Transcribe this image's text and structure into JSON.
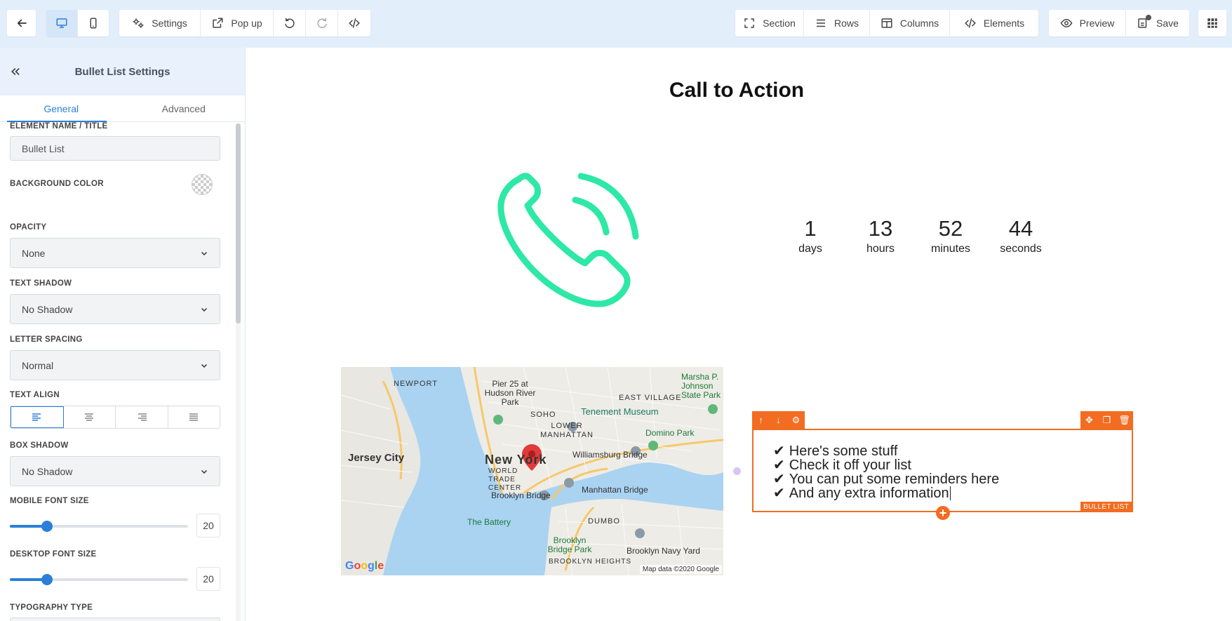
{
  "toolbar": {
    "back_icon": "arrow-left-icon",
    "devices": [
      {
        "name": "desktop",
        "icon": "desktop-icon",
        "active": true
      },
      {
        "name": "mobile",
        "icon": "mobile-icon",
        "active": false
      }
    ],
    "settings_label": "Settings",
    "popup_label": "Pop up",
    "section_label": "Section",
    "rows_label": "Rows",
    "columns_label": "Columns",
    "elements_label": "Elements",
    "preview_label": "Preview",
    "save_label": "Save"
  },
  "panel": {
    "title": "Bullet List Settings",
    "tabs": [
      {
        "label": "General",
        "active": true
      },
      {
        "label": "Advanced",
        "active": false
      }
    ],
    "fields": {
      "element_name_label": "ELEMENT NAME / TITLE",
      "element_name_value": "Bullet List",
      "bg_color_label": "BACKGROUND COLOR",
      "opacity_label": "OPACITY",
      "opacity_value": "None",
      "text_shadow_label": "TEXT SHADOW",
      "text_shadow_value": "No Shadow",
      "letter_spacing_label": "LETTER SPACING",
      "letter_spacing_value": "Normal",
      "text_align_label": "TEXT ALIGN",
      "text_align_selected": "left",
      "box_shadow_label": "BOX SHADOW",
      "box_shadow_value": "No Shadow",
      "mobile_font_label": "MOBILE FONT SIZE",
      "mobile_font_value": "20",
      "mobile_font_fraction": 0.21,
      "desktop_font_label": "DESKTOP FONT SIZE",
      "desktop_font_value": "20",
      "desktop_font_fraction": 0.21,
      "typography_label": "TYPOGRAPHY TYPE"
    }
  },
  "canvas": {
    "title": "Call to Action",
    "phone_icon": "phone-ringing-icon",
    "phone_color": "#2de8a6",
    "countdown": [
      {
        "value": "1",
        "unit": "days"
      },
      {
        "value": "13",
        "unit": "hours"
      },
      {
        "value": "52",
        "unit": "minutes"
      },
      {
        "value": "44",
        "unit": "seconds"
      }
    ],
    "map": {
      "labels": {
        "jersey_city": "Jersey City",
        "new_york": "New York",
        "newport": "NEWPORT",
        "pier25": "Pier 25 at Hudson River Park",
        "soho": "SOHO",
        "east_village": "EAST VILLAGE",
        "lower_manhattan": "LOWER MANHATTAN",
        "tenement": "Tenement Museum",
        "world_trade": "WORLD TRADE CENTER",
        "williamsburg": "Williamsburg Bridge",
        "domino": "Domino Park",
        "marsha": "Marsha P. Johnson State Park",
        "brooklyn_bridge": "Brooklyn Bridge",
        "manhattan_bridge": "Manhattan Bridge",
        "battery": "The Battery",
        "dumbo": "DUMBO",
        "navy_yard": "Brooklyn Navy Yard",
        "brooklyn_heights": "Brooklyn Bridge Park",
        "brooklyn_heights_area": "BROOKLYN HEIGHTS"
      },
      "credit": "Map data ©2020 Google",
      "logo": "Google"
    },
    "bullet_list": {
      "items": [
        "Here's some stuff",
        "Check it off your list",
        "You can put some reminders here",
        "And any extra information"
      ],
      "tag": "BULLET LIST",
      "accent": "#f26c21"
    }
  }
}
